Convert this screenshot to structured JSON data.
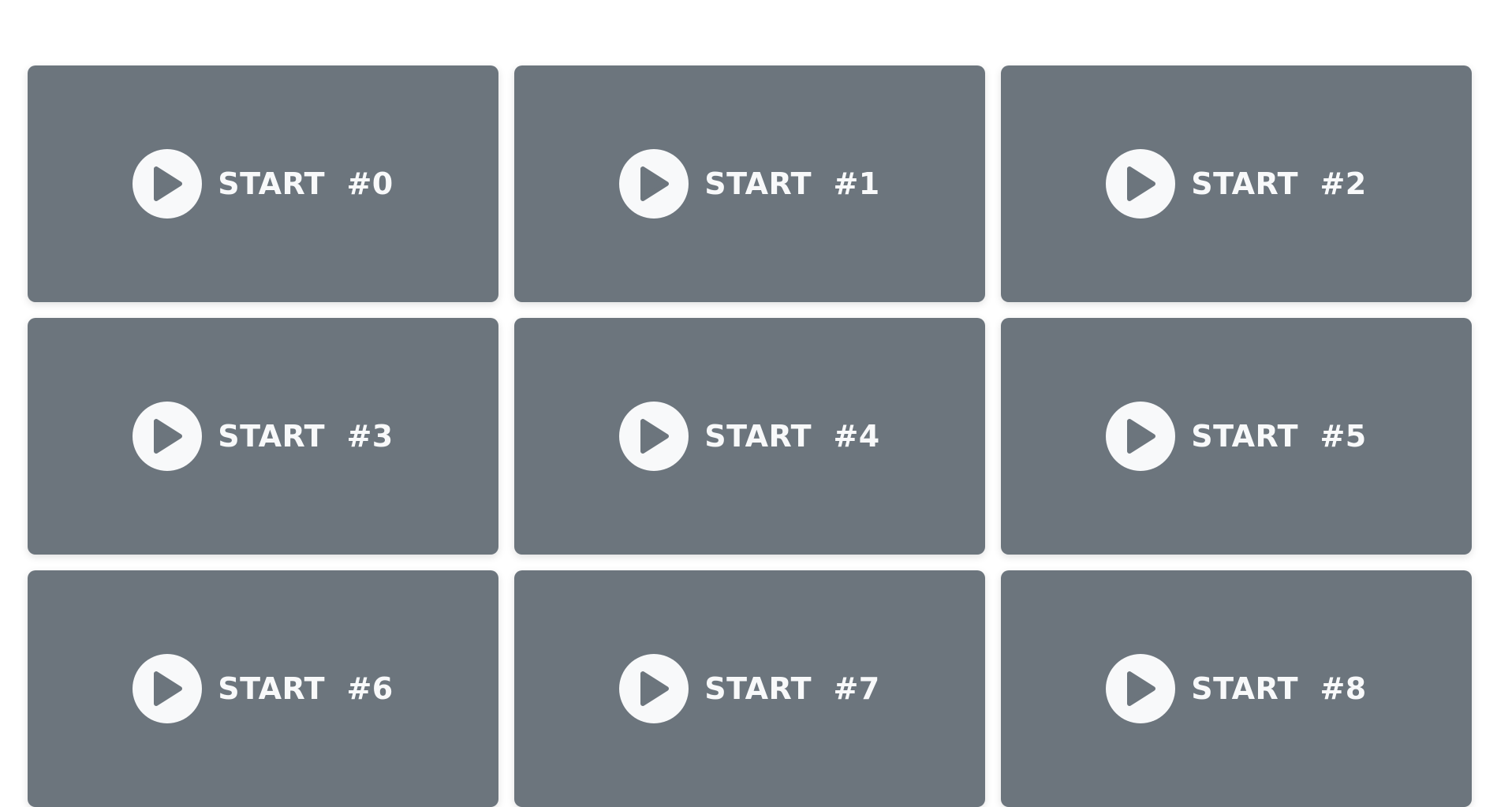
{
  "colors": {
    "page_background": "#ffffff",
    "card_background": "#6c757d",
    "icon_and_text": "#f8f9fa"
  },
  "cards": [
    {
      "label": "START  #0",
      "icon": "play-circle-icon"
    },
    {
      "label": "START  #1",
      "icon": "play-circle-icon"
    },
    {
      "label": "START  #2",
      "icon": "play-circle-icon"
    },
    {
      "label": "START  #3",
      "icon": "play-circle-icon"
    },
    {
      "label": "START  #4",
      "icon": "play-circle-icon"
    },
    {
      "label": "START  #5",
      "icon": "play-circle-icon"
    },
    {
      "label": "START  #6",
      "icon": "play-circle-icon"
    },
    {
      "label": "START  #7",
      "icon": "play-circle-icon"
    },
    {
      "label": "START  #8",
      "icon": "play-circle-icon"
    }
  ]
}
